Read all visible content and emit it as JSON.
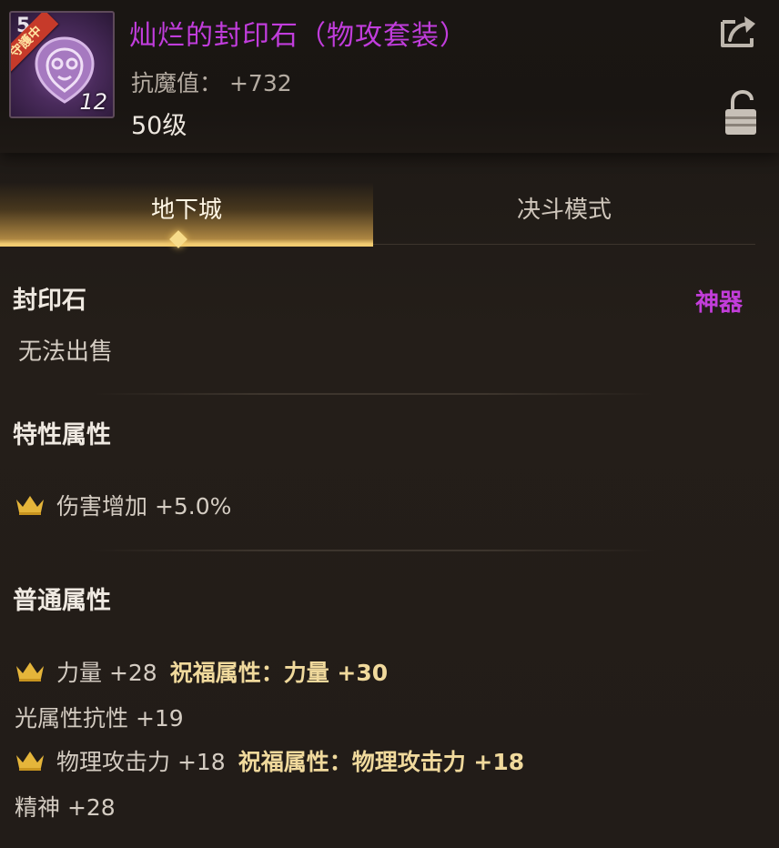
{
  "item": {
    "tier_glyph": "5",
    "ribbon_label": "守護中",
    "stack_count": "12",
    "title": "灿烂的封印石（物攻套装）",
    "stat_label": "抗魔值：",
    "stat_value": "+732",
    "level": "50级"
  },
  "tabs": [
    {
      "label": "地下城",
      "active": true
    },
    {
      "label": "决斗模式",
      "active": false
    }
  ],
  "icons": {
    "share": "share-icon",
    "lock": "lock-icon",
    "crown": "crown-icon"
  },
  "section_item": {
    "title": "封印石",
    "rarity": "神器",
    "note": "无法出售"
  },
  "section_special": {
    "title": "特性属性",
    "attrs": [
      {
        "text": "伤害增加 +5.0%"
      }
    ]
  },
  "section_normal": {
    "title": "普通属性",
    "rows": [
      {
        "text": "力量 +28",
        "bless": "祝福属性：力量 +30"
      },
      {
        "text": "光属性抗性 +19"
      },
      {
        "text": "物理攻击力 +18",
        "bless": "祝福属性：物理攻击力 +18"
      },
      {
        "text": "精神 +28"
      }
    ]
  },
  "colors": {
    "title_purple": "#c13ddc",
    "tab_gold": "#f1cb70",
    "bless_gold": "#f0d99c",
    "crown_gold": "#e5b53a"
  }
}
